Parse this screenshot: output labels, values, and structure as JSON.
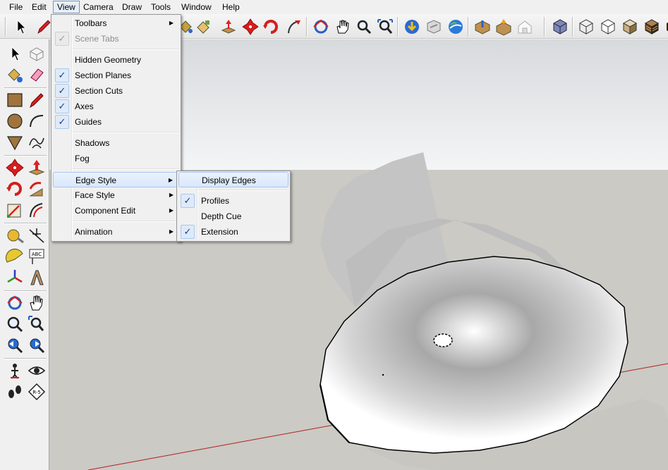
{
  "menubar": {
    "items": [
      "File",
      "Edit",
      "View",
      "Camera",
      "Draw",
      "Tools",
      "Window",
      "Help"
    ],
    "active": "View"
  },
  "toolbar": {
    "icons": [
      "select-icon",
      "pencil-icon",
      "paint-bucket-icon",
      "paint-icon",
      "push-pull-icon",
      "move-icon",
      "rotate-icon",
      "follow-me-icon",
      "orbit-icon",
      "pan-icon",
      "zoom-icon",
      "zoom-extents-icon",
      "get-models-icon",
      "share-model-icon",
      "google-earth-icon",
      "components-icon",
      "upload-component-icon",
      "warehouse-icon",
      "iso-view-icon",
      "wireframe-icon",
      "hidden-line-icon",
      "shaded-icon",
      "textured-icon"
    ]
  },
  "left_toolbar": {
    "icons": [
      "select-icon",
      "make-component-icon",
      "paint-bucket-icon",
      "eraser-icon",
      "rectangle-icon",
      "line-icon",
      "circle-icon",
      "arc-icon",
      "polygon-icon",
      "freehand-icon",
      "move-icon",
      "push-pull-icon",
      "rotate-icon",
      "follow-me-icon",
      "scale-icon",
      "offset-icon",
      "tape-measure-icon",
      "dimension-icon",
      "protractor-icon",
      "text-icon",
      "axes-icon",
      "3d-text-icon",
      "orbit-icon",
      "pan-icon",
      "zoom-icon",
      "zoom-window-icon",
      "previous-icon",
      "next-icon",
      "position-camera-icon",
      "look-around-icon",
      "walk-icon",
      "section-plane-icon"
    ]
  },
  "view_menu": {
    "items": [
      {
        "label": "Toolbars",
        "submenu": true
      },
      {
        "label": "Scene Tabs",
        "checked": true,
        "disabled": true
      },
      {
        "label": "Hidden Geometry"
      },
      {
        "label": "Section Planes",
        "checked": true
      },
      {
        "label": "Section Cuts",
        "checked": true
      },
      {
        "label": "Axes",
        "checked": true
      },
      {
        "label": "Guides",
        "checked": true
      },
      {
        "label": "Shadows"
      },
      {
        "label": "Fog"
      },
      {
        "label": "Edge Style",
        "submenu": true,
        "highlighted": true
      },
      {
        "label": "Face Style",
        "submenu": true
      },
      {
        "label": "Component Edit",
        "submenu": true
      },
      {
        "label": "Animation",
        "submenu": true
      }
    ]
  },
  "edge_style_menu": {
    "items": [
      {
        "label": "Display Edges",
        "highlighted": true
      },
      {
        "label": "Profiles",
        "checked": true
      },
      {
        "label": "Depth Cue"
      },
      {
        "label": "Extension",
        "checked": true
      }
    ]
  },
  "glyphs": {
    "check": "✓",
    "arrow": "▶"
  },
  "colors": {
    "menu_bg": "#f0f0f0",
    "highlight": "#d9e8fb",
    "sky": "#f4f5f6",
    "ground": "#cbcac4",
    "red_axis": "#b02020",
    "model_edge": "#000000"
  }
}
